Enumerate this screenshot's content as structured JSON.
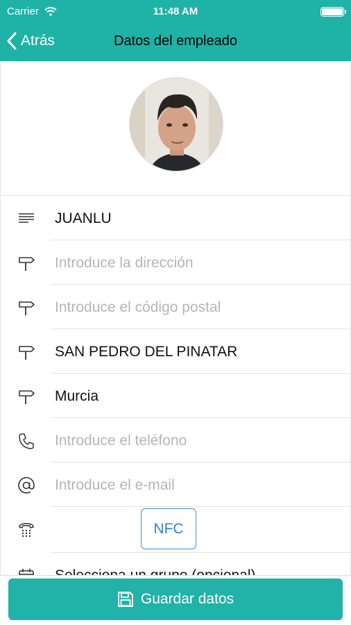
{
  "status_bar": {
    "carrier": "Carrier",
    "time": "11:48 AM"
  },
  "nav": {
    "back_label": "Atrás",
    "title": "Datos del empleado"
  },
  "form": {
    "name": "JUANLU",
    "address_placeholder": "Introduce la dirección",
    "postal_code_placeholder": "Introduce el código postal",
    "city": "SAN PEDRO DEL PINATAR",
    "province": "Murcia",
    "phone_placeholder": "Introduce el teléfono",
    "email_placeholder": "Introduce el e-mail",
    "nfc_label": "NFC",
    "group_placeholder": "Selecciona un grupo (opcional)"
  },
  "footer": {
    "save_label": "Guardar datos"
  },
  "colors": {
    "accent": "#1fb2a7",
    "link_blue": "#2f80d8",
    "placeholder": "#b5b5b5"
  },
  "icons": [
    "wifi-icon",
    "battery-icon",
    "back-chevron-icon",
    "text-lines-icon",
    "signpost-icon",
    "phone-icon",
    "at-sign-icon",
    "desk-phone-icon",
    "calendar-icon",
    "floppy-disk-icon"
  ]
}
